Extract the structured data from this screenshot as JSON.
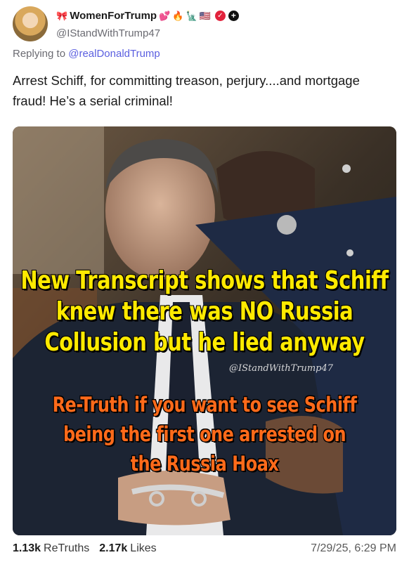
{
  "post": {
    "author": {
      "display_name": "WomenForTrump",
      "handle": "@IStandWithTrump47",
      "badges": [
        "🎀",
        "💕",
        "🔥",
        "🗽",
        "🇺🇸"
      ],
      "avatar_icon": "avatar"
    },
    "reply": {
      "prefix": "Replying to",
      "mention": "@realDonaldTrump"
    },
    "text": "Arrest Schiff, for committing treason, perjury....and mortgage fraud! He’s a serial criminal!",
    "image": {
      "headline_lines": [
        "New Transcript shows that Schiff",
        "knew there was NO Russia",
        "Collusion but he lied anyway"
      ],
      "watermark": "@IStandWithTrump47",
      "call_lines": [
        "Re-Truth if you want to see Schiff",
        "being the first one arrested on",
        "the Russia Hoax"
      ],
      "colors": {
        "headline": "#ffea00",
        "call": "#ff6a1a"
      }
    },
    "stats": {
      "retruths_count": "1.13k",
      "retruths_label": "ReTruths",
      "likes_count": "2.17k",
      "likes_label": "Likes"
    },
    "timestamp": "7/29/25, 6:29 PM"
  }
}
